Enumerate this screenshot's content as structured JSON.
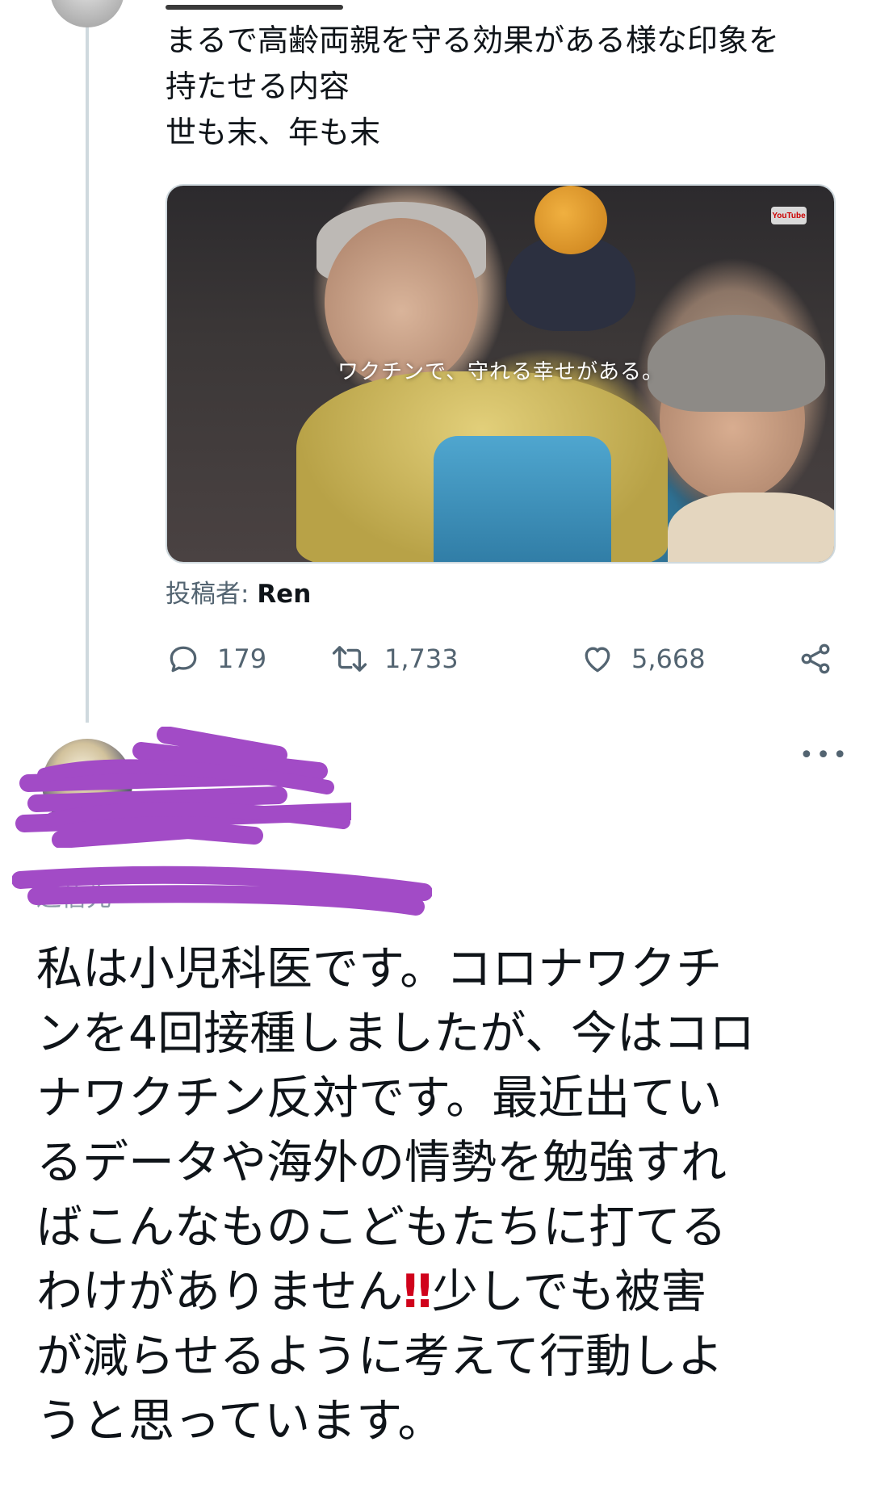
{
  "tweet": {
    "text_lines": [
      "まるで高齢両親を守る効果がある様な印象を",
      "持たせる内容",
      "世も末、年も末"
    ],
    "media": {
      "badge": "YouTube",
      "caption": "ワクチンで、守れる幸せがある。"
    },
    "poster_label": "投稿者:",
    "poster_name": "Ren",
    "reply_count": "179",
    "retweet_count": "1,733",
    "like_count": "5,668"
  },
  "reply": {
    "more_label": "•••",
    "reply_to_label": "返信先",
    "text_lines": [
      "私は小児科医です。コロナワクチ",
      "ンを4回接種しましたが、今はコロ",
      "ナワクチン反対です。最近出てい",
      "るデータや海外の情勢を勉強すれ",
      "ばこんなものこどもたちに打てる"
    ],
    "line6_pre": "わけがありません",
    "line6_emoji": "‼",
    "line6_post": "少しでも被害",
    "text_lines_end": [
      "が減らせるように考えて行動しよ",
      "うと思っています。"
    ]
  },
  "colors": {
    "text": "#0f1419",
    "muted": "#536471",
    "thread_line": "#cfd9de",
    "redaction": "#a24bc6",
    "emoji_red": "#d0021b"
  },
  "icons": [
    "reply-icon",
    "retweet-icon",
    "like-icon",
    "share-icon",
    "more-icon"
  ]
}
